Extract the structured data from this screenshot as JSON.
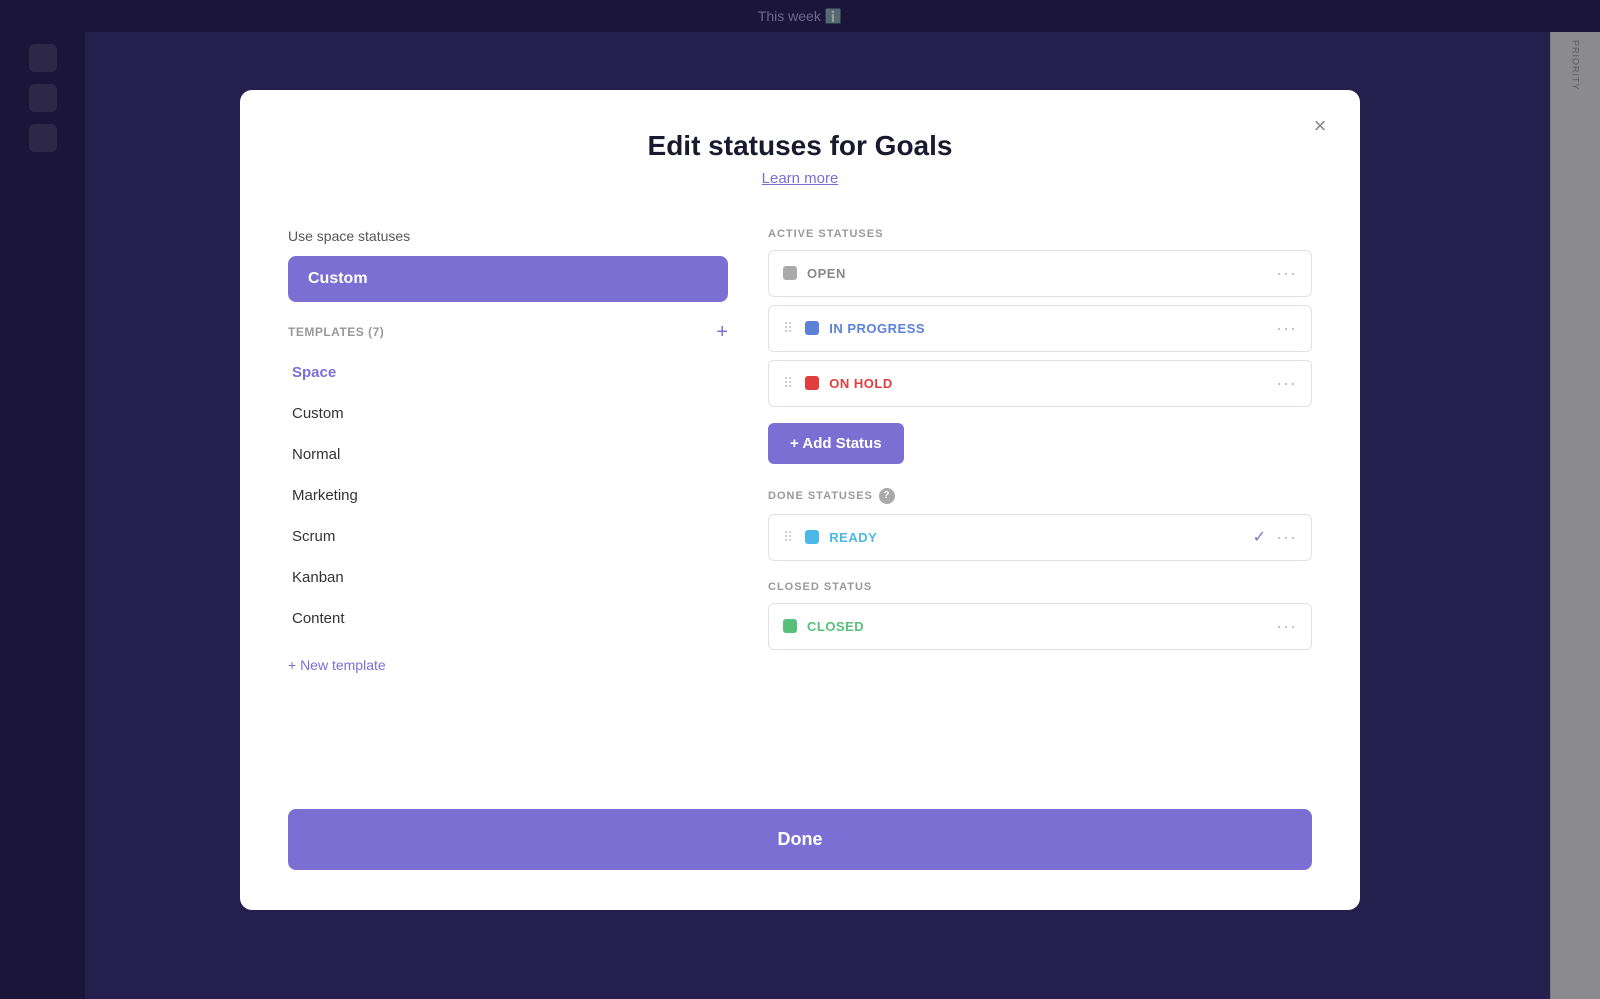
{
  "app": {
    "topbar_title": "This week",
    "priority_label": "PRIORITY"
  },
  "modal": {
    "title": "Edit statuses for Goals",
    "learn_more": "Learn more",
    "close_label": "×",
    "use_space_label": "Use space statuses",
    "selected_option": "Custom",
    "templates_label": "TEMPLATES (7)",
    "templates_add": "+",
    "template_items": [
      {
        "label": "Space",
        "active": true
      },
      {
        "label": "Custom",
        "active": false
      },
      {
        "label": "Normal",
        "active": false
      },
      {
        "label": "Marketing",
        "active": false
      },
      {
        "label": "Scrum",
        "active": false
      },
      {
        "label": "Kanban",
        "active": false
      },
      {
        "label": "Content",
        "active": false
      }
    ],
    "new_template": "+ New template",
    "active_statuses_label": "ACTIVE STATUSES",
    "active_statuses": [
      {
        "name": "OPEN",
        "color": "gray",
        "dot_class": "dot-gray",
        "name_class": "status-open"
      },
      {
        "name": "IN PROGRESS",
        "color": "purple",
        "dot_class": "dot-purple",
        "name_class": "status-inprogress"
      },
      {
        "name": "ON HOLD",
        "color": "red",
        "dot_class": "dot-red",
        "name_class": "status-onhold"
      }
    ],
    "add_status_label": "+ Add Status",
    "done_statuses_label": "DONE STATUSES",
    "done_statuses": [
      {
        "name": "READY",
        "color": "blue",
        "dot_class": "dot-blue",
        "name_class": "status-ready",
        "check": true
      }
    ],
    "closed_status_label": "CLOSED STATUS",
    "closed_statuses": [
      {
        "name": "CLOSED",
        "color": "green",
        "dot_class": "dot-green",
        "name_class": "status-closed"
      }
    ],
    "done_button": "Done"
  }
}
